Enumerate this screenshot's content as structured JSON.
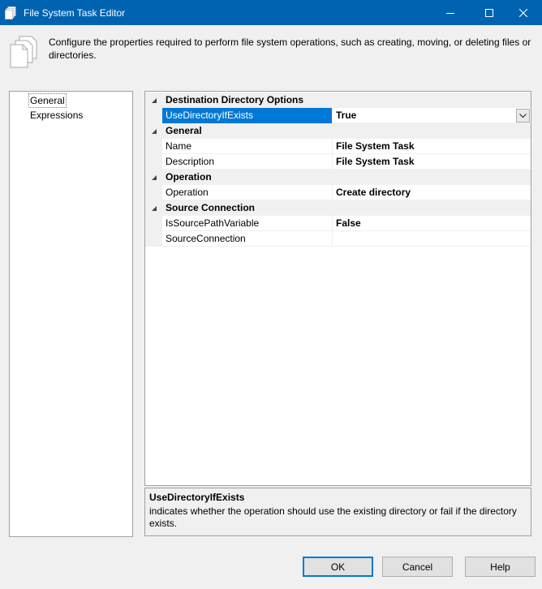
{
  "window": {
    "title": "File System Task Editor",
    "titlebar_color": "#0063b1"
  },
  "header": {
    "icon": "documents-icon",
    "description": "Configure the properties required to perform file system operations, such as creating, moving, or deleting files or directories."
  },
  "nav": {
    "items": [
      {
        "label": "General",
        "selected": true
      },
      {
        "label": "Expressions",
        "selected": false
      }
    ]
  },
  "grid": {
    "categories": [
      {
        "label": "Destination Directory Options",
        "properties": [
          {
            "name": "UseDirectoryIfExists",
            "value": "True",
            "selected": true,
            "has_dropdown": true
          }
        ]
      },
      {
        "label": "General",
        "properties": [
          {
            "name": "Name",
            "value": "File System Task"
          },
          {
            "name": "Description",
            "value": "File System Task"
          }
        ]
      },
      {
        "label": "Operation",
        "properties": [
          {
            "name": "Operation",
            "value": "Create directory"
          }
        ]
      },
      {
        "label": "Source Connection",
        "properties": [
          {
            "name": "IsSourcePathVariable",
            "value": "False"
          },
          {
            "name": "SourceConnection",
            "value": ""
          }
        ]
      }
    ],
    "selection_color": "#0078d7"
  },
  "description_panel": {
    "title": "UseDirectoryIfExists",
    "text": "indicates whether the operation should use the existing directory or fail if the directory exists."
  },
  "buttons": {
    "ok": "OK",
    "cancel": "Cancel",
    "help": "Help"
  }
}
